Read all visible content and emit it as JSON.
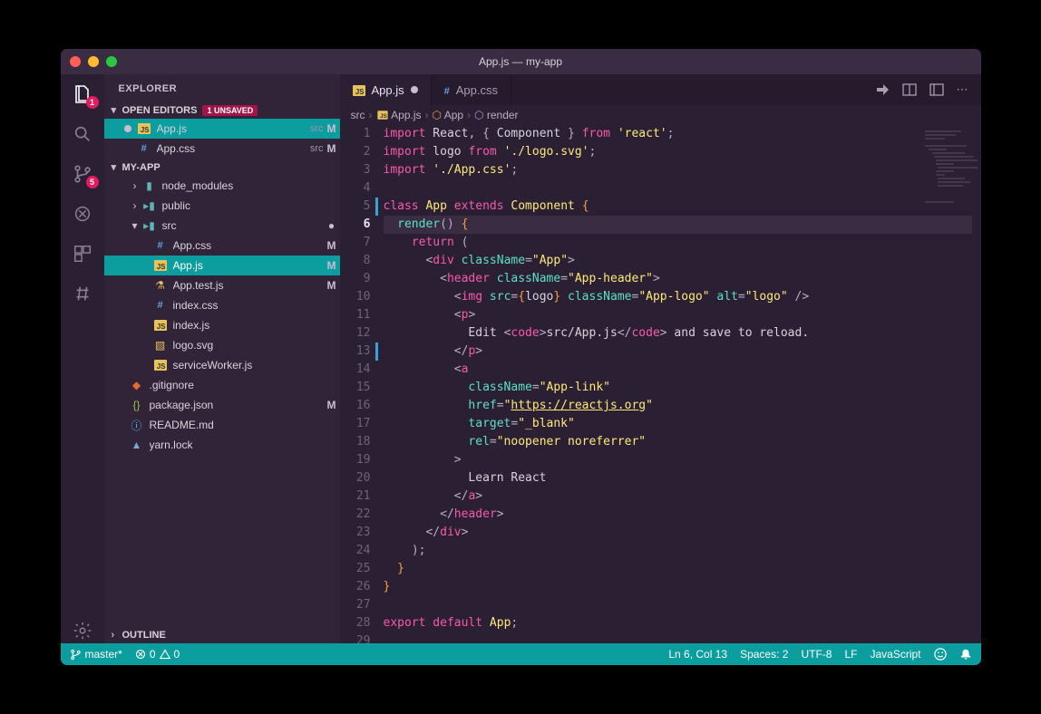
{
  "window_title": "App.js — my-app",
  "explorer_label": "EXPLORER",
  "open_editors": {
    "label": "OPEN EDITORS",
    "unsaved_badge": "1 UNSAVED"
  },
  "editors": [
    {
      "name": "App.js",
      "dir": "src",
      "status": "M",
      "modified": true,
      "icon": "js"
    },
    {
      "name": "App.css",
      "dir": "src",
      "status": "M",
      "modified": false,
      "icon": "css"
    }
  ],
  "project_name": "MY-APP",
  "tree": [
    {
      "name": "node_modules",
      "type": "folder-mod",
      "indent": 1,
      "twisty": "›"
    },
    {
      "name": "public",
      "type": "folder",
      "indent": 1,
      "twisty": "›"
    },
    {
      "name": "src",
      "type": "folder",
      "indent": 1,
      "twisty": "▾",
      "status": "●"
    },
    {
      "name": "App.css",
      "type": "css",
      "indent": 3,
      "status": "M"
    },
    {
      "name": "App.js",
      "type": "js",
      "indent": 3,
      "status": "M",
      "active": true
    },
    {
      "name": "App.test.js",
      "type": "flask",
      "indent": 3,
      "status": "M"
    },
    {
      "name": "index.css",
      "type": "css",
      "indent": 3
    },
    {
      "name": "index.js",
      "type": "js",
      "indent": 3
    },
    {
      "name": "logo.svg",
      "type": "svg",
      "indent": 3
    },
    {
      "name": "serviceWorker.js",
      "type": "js",
      "indent": 3
    },
    {
      "name": ".gitignore",
      "type": "git",
      "indent": 1
    },
    {
      "name": "package.json",
      "type": "json",
      "indent": 1,
      "status": "M"
    },
    {
      "name": "README.md",
      "type": "info",
      "indent": 1
    },
    {
      "name": "yarn.lock",
      "type": "yarn",
      "indent": 1
    }
  ],
  "outline_label": "OUTLINE",
  "tabs": [
    {
      "name": "App.js",
      "icon": "js",
      "modified": true,
      "active": true
    },
    {
      "name": "App.css",
      "icon": "css",
      "modified": false,
      "active": false
    }
  ],
  "breadcrumb": [
    "src",
    "App.js",
    "App",
    "render"
  ],
  "breadcrumb_icons": [
    "",
    "js",
    "class",
    "method"
  ],
  "activity_badges": {
    "explorer": "1",
    "scm": "5"
  },
  "code": {
    "active_line": 6,
    "modified_lines": [
      5,
      13
    ],
    "lines": [
      [
        [
          "kw",
          "import"
        ],
        [
          "txt",
          " React"
        ],
        [
          "punc",
          ", { "
        ],
        [
          "txt",
          "Component"
        ],
        [
          "punc",
          " } "
        ],
        [
          "kw",
          "from"
        ],
        [
          "txt",
          " "
        ],
        [
          "str",
          "'react'"
        ],
        [
          "punc",
          ";"
        ]
      ],
      [
        [
          "kw",
          "import"
        ],
        [
          "txt",
          " logo "
        ],
        [
          "kw",
          "from"
        ],
        [
          "txt",
          " "
        ],
        [
          "str",
          "'./logo.svg'"
        ],
        [
          "punc",
          ";"
        ]
      ],
      [
        [
          "kw",
          "import"
        ],
        [
          "txt",
          " "
        ],
        [
          "str",
          "'./App.css'"
        ],
        [
          "punc",
          ";"
        ]
      ],
      [],
      [
        [
          "kw",
          "class"
        ],
        [
          "txt",
          " "
        ],
        [
          "cls",
          "App"
        ],
        [
          "txt",
          " "
        ],
        [
          "kw",
          "extends"
        ],
        [
          "txt",
          " "
        ],
        [
          "cls",
          "Component"
        ],
        [
          "txt",
          " "
        ],
        [
          "brace",
          "{"
        ]
      ],
      [
        [
          "txt",
          "  "
        ],
        [
          "fn",
          "render"
        ],
        [
          "punc",
          "() "
        ],
        [
          "brace",
          "{"
        ]
      ],
      [
        [
          "txt",
          "    "
        ],
        [
          "kw",
          "return"
        ],
        [
          "txt",
          " "
        ],
        [
          "punc",
          "("
        ]
      ],
      [
        [
          "txt",
          "      "
        ],
        [
          "punc",
          "<"
        ],
        [
          "tag",
          "div"
        ],
        [
          "txt",
          " "
        ],
        [
          "attr",
          "className"
        ],
        [
          "punc",
          "="
        ],
        [
          "str",
          "\"App\""
        ],
        [
          "punc",
          ">"
        ]
      ],
      [
        [
          "txt",
          "        "
        ],
        [
          "punc",
          "<"
        ],
        [
          "tag",
          "header"
        ],
        [
          "txt",
          " "
        ],
        [
          "attr",
          "className"
        ],
        [
          "punc",
          "="
        ],
        [
          "str",
          "\"App-header\""
        ],
        [
          "punc",
          ">"
        ]
      ],
      [
        [
          "txt",
          "          "
        ],
        [
          "punc",
          "<"
        ],
        [
          "tag",
          "img"
        ],
        [
          "txt",
          " "
        ],
        [
          "attr",
          "src"
        ],
        [
          "punc",
          "="
        ],
        [
          "brace",
          "{"
        ],
        [
          "txt",
          "logo"
        ],
        [
          "brace",
          "}"
        ],
        [
          "txt",
          " "
        ],
        [
          "attr",
          "className"
        ],
        [
          "punc",
          "="
        ],
        [
          "str",
          "\"App-logo\""
        ],
        [
          "txt",
          " "
        ],
        [
          "attr",
          "alt"
        ],
        [
          "punc",
          "="
        ],
        [
          "str",
          "\"logo\""
        ],
        [
          "txt",
          " "
        ],
        [
          "punc",
          "/>"
        ]
      ],
      [
        [
          "txt",
          "          "
        ],
        [
          "punc",
          "<"
        ],
        [
          "tag",
          "p"
        ],
        [
          "punc",
          ">"
        ]
      ],
      [
        [
          "txt",
          "            Edit "
        ],
        [
          "punc",
          "<"
        ],
        [
          "tag",
          "code"
        ],
        [
          "punc",
          ">"
        ],
        [
          "txt",
          "src/App.js"
        ],
        [
          "punc",
          "</"
        ],
        [
          "tag",
          "code"
        ],
        [
          "punc",
          ">"
        ],
        [
          "txt",
          " and save to reload."
        ]
      ],
      [
        [
          "txt",
          "          "
        ],
        [
          "punc",
          "</"
        ],
        [
          "tag",
          "p"
        ],
        [
          "punc",
          ">"
        ]
      ],
      [
        [
          "txt",
          "          "
        ],
        [
          "punc",
          "<"
        ],
        [
          "tag",
          "a"
        ]
      ],
      [
        [
          "txt",
          "            "
        ],
        [
          "attr",
          "className"
        ],
        [
          "punc",
          "="
        ],
        [
          "str",
          "\"App-link\""
        ]
      ],
      [
        [
          "txt",
          "            "
        ],
        [
          "attr",
          "href"
        ],
        [
          "punc",
          "="
        ],
        [
          "str",
          "\""
        ],
        [
          "str link",
          "https://reactjs.org"
        ],
        [
          "str",
          "\""
        ]
      ],
      [
        [
          "txt",
          "            "
        ],
        [
          "attr",
          "target"
        ],
        [
          "punc",
          "="
        ],
        [
          "str",
          "\"_blank\""
        ]
      ],
      [
        [
          "txt",
          "            "
        ],
        [
          "attr",
          "rel"
        ],
        [
          "punc",
          "="
        ],
        [
          "str",
          "\"noopener noreferrer\""
        ]
      ],
      [
        [
          "txt",
          "          "
        ],
        [
          "punc",
          ">"
        ]
      ],
      [
        [
          "txt",
          "            Learn React"
        ]
      ],
      [
        [
          "txt",
          "          "
        ],
        [
          "punc",
          "</"
        ],
        [
          "tag",
          "a"
        ],
        [
          "punc",
          ">"
        ]
      ],
      [
        [
          "txt",
          "        "
        ],
        [
          "punc",
          "</"
        ],
        [
          "tag",
          "header"
        ],
        [
          "punc",
          ">"
        ]
      ],
      [
        [
          "txt",
          "      "
        ],
        [
          "punc",
          "</"
        ],
        [
          "tag",
          "div"
        ],
        [
          "punc",
          ">"
        ]
      ],
      [
        [
          "txt",
          "    "
        ],
        [
          "punc",
          ");"
        ]
      ],
      [
        [
          "txt",
          "  "
        ],
        [
          "brace",
          "}"
        ]
      ],
      [
        [
          "brace",
          "}"
        ]
      ],
      [],
      [
        [
          "kw",
          "export"
        ],
        [
          "txt",
          " "
        ],
        [
          "kw",
          "default"
        ],
        [
          "txt",
          " "
        ],
        [
          "cls",
          "App"
        ],
        [
          "punc",
          ";"
        ]
      ],
      []
    ]
  },
  "status": {
    "branch": "master*",
    "errors": "0",
    "warnings": "0",
    "position": "Ln 6, Col 13",
    "spaces": "Spaces: 2",
    "encoding": "UTF-8",
    "eol": "LF",
    "language": "JavaScript"
  }
}
